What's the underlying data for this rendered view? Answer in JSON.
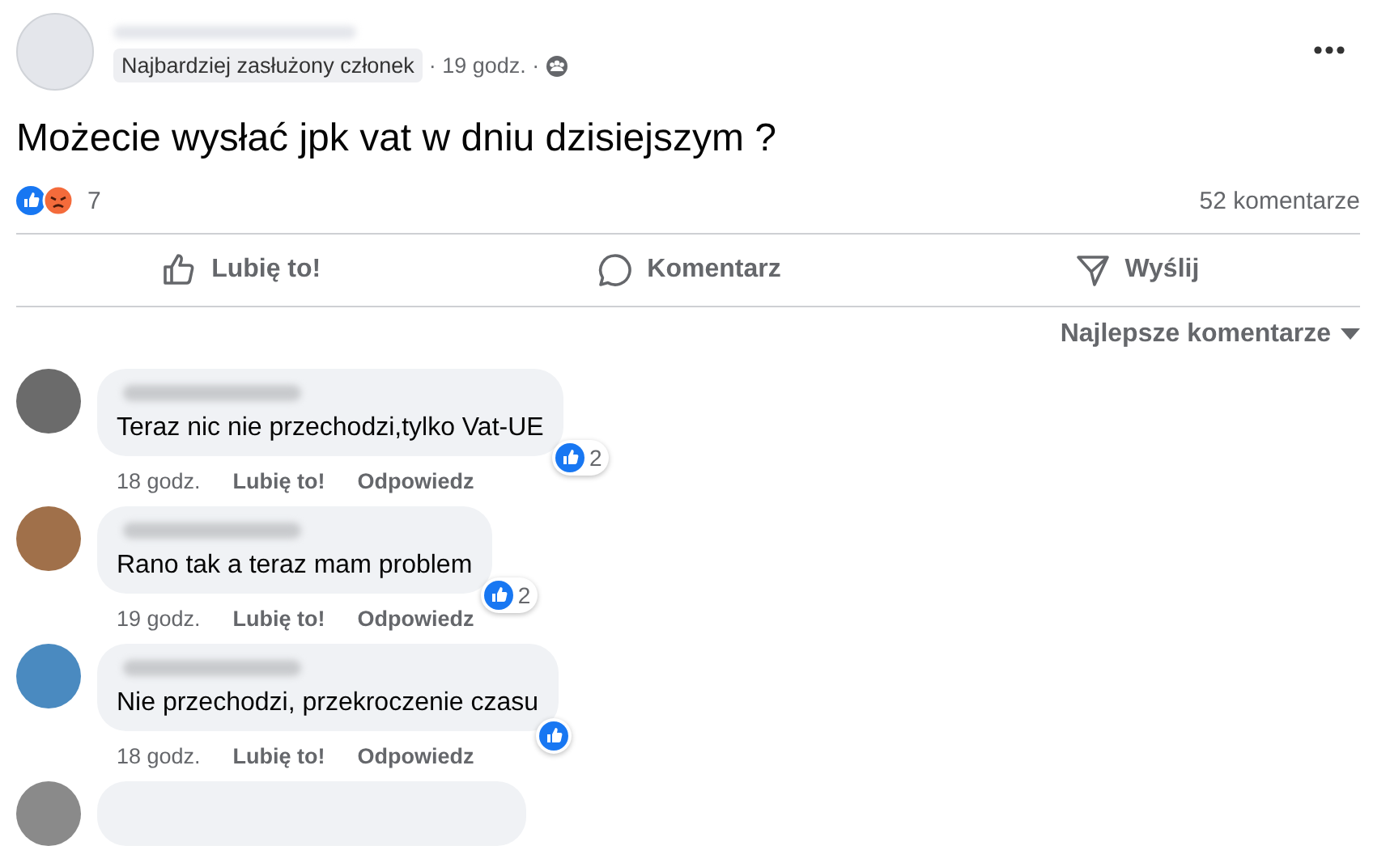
{
  "post": {
    "badge": "Najbardziej zasłużony członek",
    "time": "· 19 godz. ·",
    "text": "Możecie wysłać jpk vat w dniu dzisiejszym ?",
    "reaction_count": "7",
    "comment_count": "52 komentarze"
  },
  "actions": [
    {
      "kind": "like",
      "label": "Lubię to!"
    },
    {
      "kind": "comment",
      "label": "Komentarz"
    },
    {
      "kind": "send",
      "label": "Wyślij"
    }
  ],
  "sort": "Najlepsze komentarze",
  "comments": [
    {
      "text": "Teraz nic nie przechodzi,tylko Vat-UE",
      "time": "18 godz.",
      "like": "Lubię to!",
      "reply": "Odpowiedz",
      "reactions": "2"
    },
    {
      "text": "Rano tak a teraz mam problem",
      "time": "19 godz.",
      "like": "Lubię to!",
      "reply": "Odpowiedz",
      "reactions": "2"
    },
    {
      "text": "Nie przechodzi, przekroczenie czasu",
      "time": "18 godz.",
      "like": "Lubię to!",
      "reply": "Odpowiedz"
    }
  ]
}
